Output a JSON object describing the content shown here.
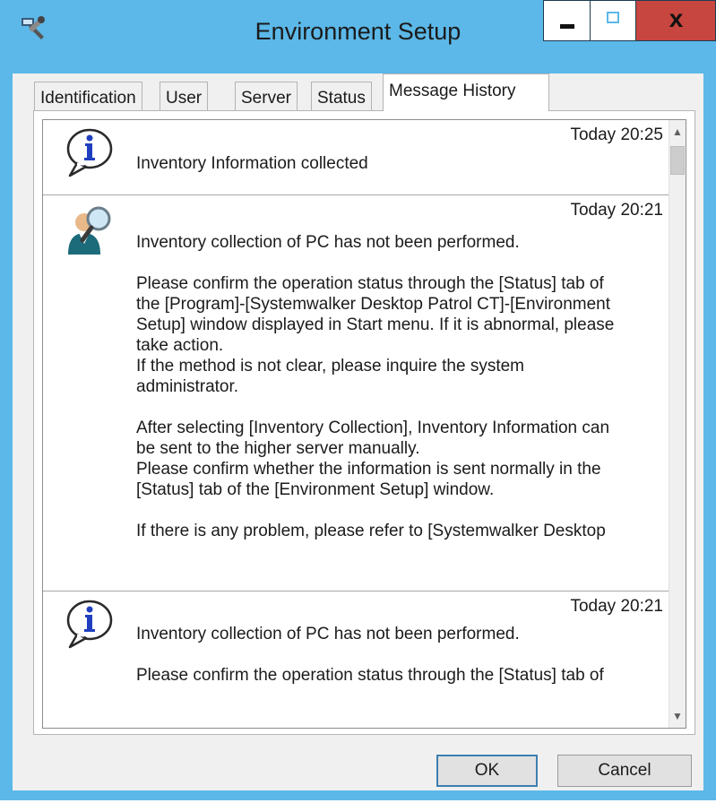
{
  "window": {
    "title": "Environment Setup",
    "controls": {
      "close_label": "x"
    }
  },
  "tabs": [
    {
      "label": "Identification",
      "active": false
    },
    {
      "label": "User",
      "active": false
    },
    {
      "label": "Server",
      "active": false
    },
    {
      "label": "Status",
      "active": false
    },
    {
      "label": "Message History",
      "active": true
    }
  ],
  "messages": [
    {
      "icon": "info-icon",
      "time": "Today 20:25",
      "text": "Inventory Information collected"
    },
    {
      "icon": "user-search-icon",
      "time": "Today 20:21",
      "text": "Inventory collection of PC has not been performed.\n\nPlease confirm the operation status through the [Status] tab of\nthe [Program]-[Systemwalker Desktop Patrol CT]-[Environment\nSetup] window displayed in Start menu. If it is abnormal, please\ntake action.\nIf the method is not clear, please inquire the system\nadministrator.\n\nAfter selecting [Inventory Collection], Inventory Information can\nbe sent to the higher server manually.\nPlease confirm whether the information is sent normally in the\n[Status] tab of the [Environment Setup] window.\n\nIf there is any problem, please refer to [Systemwalker Desktop"
    },
    {
      "icon": "info-icon",
      "time": "Today 20:21",
      "text": "Inventory collection of PC has not been performed.\n\nPlease confirm the operation status through the [Status] tab of"
    }
  ],
  "buttons": {
    "ok": "OK",
    "cancel": "Cancel"
  },
  "colors": {
    "titlebar": "#5bb8e8",
    "close": "#c7463f",
    "info_blue": "#1f3fbf"
  }
}
